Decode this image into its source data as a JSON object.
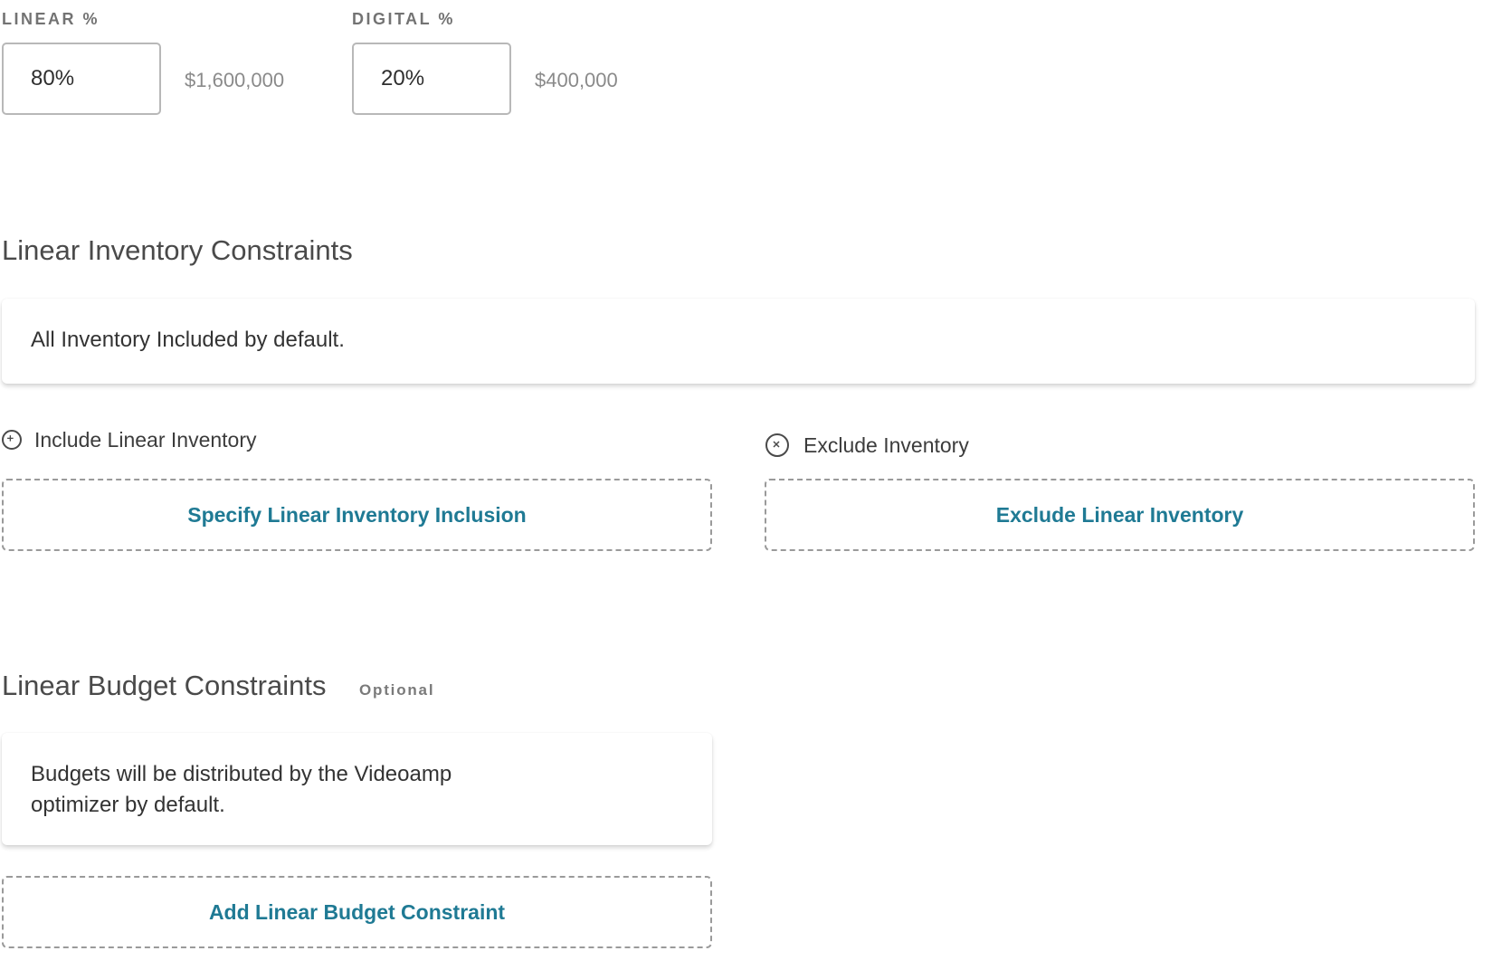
{
  "split": {
    "linear": {
      "label": "LINEAR %",
      "value": "80%",
      "amount": "$1,600,000"
    },
    "digital": {
      "label": "DIGITAL %",
      "value": "20%",
      "amount": "$400,000"
    }
  },
  "inventory": {
    "title": "Linear Inventory Constraints",
    "default_text": "All Inventory Included by default.",
    "include": {
      "label": "Include Linear Inventory",
      "icon": "plus-circle-icon",
      "button": "Specify Linear Inventory Inclusion"
    },
    "exclude": {
      "label": "Exclude Inventory",
      "icon": "x-circle-icon",
      "button": "Exclude Linear Inventory"
    }
  },
  "budget": {
    "title": "Linear Budget Constraints",
    "optional_tag": "Optional",
    "default_line1": "Budgets will be distributed by the Videoamp",
    "default_line2": "optimizer by default.",
    "button": "Add Linear Budget Constraint"
  },
  "colors": {
    "accent": "#1f7a94",
    "muted_text": "#8a8a8a",
    "border": "#b8b8b8"
  }
}
